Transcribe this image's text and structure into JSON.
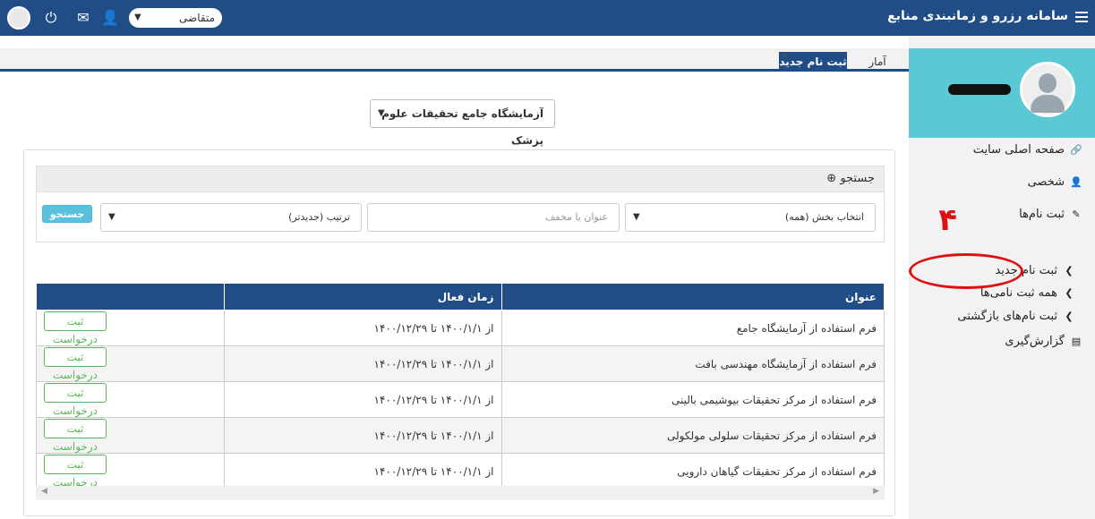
{
  "app": {
    "title": "سامانه رزرو و زمانبندی منابع",
    "role": "متقاضی",
    "brand_color": "#204d86",
    "accent_color": "#5bc8d6"
  },
  "tabs": [
    {
      "label": "ثبت نام جدید",
      "active": true,
      "close": "×"
    },
    {
      "label": "آمار",
      "active": false
    }
  ],
  "lab_select": {
    "value": "آزمایشگاه جامع تحقیقات علوم پزشک"
  },
  "sidebar": {
    "items": [
      {
        "label": "صفحه اصلی سایت",
        "icon": "link-icon"
      },
      {
        "label": "شخصی",
        "icon": "user-icon"
      },
      {
        "label": "ثبت نام‌ها",
        "icon": "edit-icon"
      },
      {
        "label": "ثبت نام جدید",
        "icon": "chevron-right-icon"
      },
      {
        "label": "همه ثبت نامی‌ها",
        "icon": "chevron-right-icon"
      },
      {
        "label": "ثبت نام‌های بازگشتی",
        "icon": "chevron-right-icon"
      },
      {
        "label": "گزارش‌گیری",
        "icon": "list-icon"
      }
    ],
    "annotation_number": "۴"
  },
  "search": {
    "header": "جستجو",
    "section_select": "انتخاب بخش (همه)",
    "title_placeholder": "عنوان یا مخفف",
    "sort_select": "ترتیب (جدیدتر)",
    "button": "جستجو"
  },
  "table": {
    "headers": [
      "عنوان",
      "زمان فعال",
      ""
    ],
    "rows": [
      {
        "title": "فرم استفاده از آزمایشگاه جامع",
        "time": "از ۱۴۰۰/۱/۱ تا ۱۴۰۰/۱۲/۲۹",
        "action": "ثبت درخواست"
      },
      {
        "title": "فرم استفاده از آزمایشگاه مهندسی بافت",
        "time": "از ۱۴۰۰/۱/۱ تا ۱۴۰۰/۱۲/۲۹",
        "action": "ثبت درخواست"
      },
      {
        "title": "فرم استفاده از مرکز تحقیقات بیوشیمی بالینی",
        "time": "از ۱۴۰۰/۱/۱ تا ۱۴۰۰/۱۲/۲۹",
        "action": "ثبت درخواست"
      },
      {
        "title": "فرم استفاده از مرکز تحقیقات سلولی مولکولی",
        "time": "از ۱۴۰۰/۱/۱ تا ۱۴۰۰/۱۲/۲۹",
        "action": "ثبت درخواست"
      },
      {
        "title": "فرم استفاده از مرکز تحقیقات گیاهان دارویی",
        "time": "از ۱۴۰۰/۱/۱ تا ۱۴۰۰/۱۲/۲۹",
        "action": "ثبت درخواست"
      }
    ]
  }
}
